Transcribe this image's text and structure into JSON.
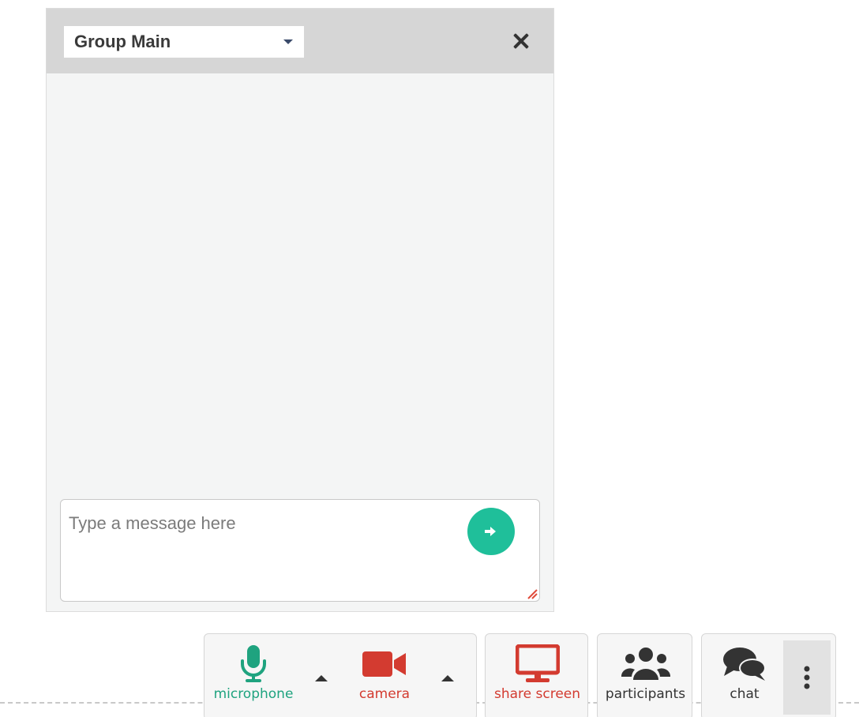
{
  "chat": {
    "group_selected": "Group Main",
    "message_placeholder": "Type a message here"
  },
  "toolbar": {
    "microphone_label": "microphone",
    "camera_label": "camera",
    "share_screen_label": "share screen",
    "participants_label": "participants",
    "chat_label": "chat"
  },
  "icons": {
    "microphone": "microphone-icon",
    "camera": "video-camera-icon",
    "share_screen": "monitor-icon",
    "participants": "users-icon",
    "chat": "comments-icon",
    "more": "vertical-ellipsis-icon",
    "send": "arrow-right-icon",
    "close": "close-icon"
  },
  "colors": {
    "microphone": "#1fa37f",
    "camera": "#d33b30",
    "share_screen": "#d33b30",
    "send_button": "#1fbf9a",
    "neutral_icon": "#333333"
  }
}
